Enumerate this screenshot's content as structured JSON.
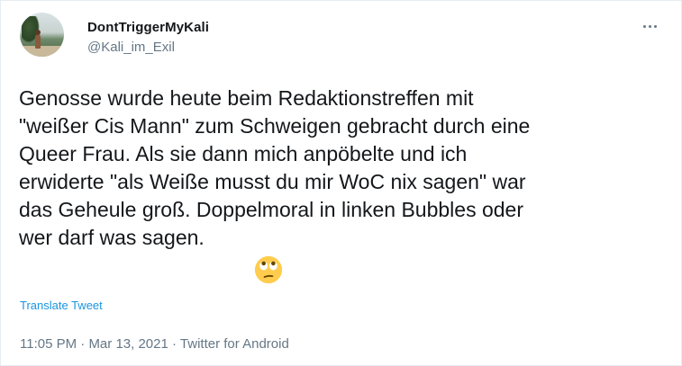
{
  "tweet": {
    "display_name": "DontTriggerMyKali",
    "handle": "@Kali_im_Exil",
    "text_lines": [
      "Genosse wurde heute beim Redaktionstreffen mit",
      "\"weißer Cis Mann\" zum Schweigen gebracht durch eine",
      "Queer Frau. Als sie dann mich anpöbelte und ich",
      "erwiderte \"als Weiße musst du mir WoC nix sagen\" war",
      "das Geheule groß. Doppelmoral in linken Bubbles oder",
      "wer darf was sagen."
    ],
    "emoji": "face-with-rolling-eyes",
    "translate_label": "Translate Tweet",
    "time": "11:05 PM",
    "separator": "·",
    "date": "Mar 13, 2021",
    "source": "Twitter for Android"
  },
  "icons": {
    "more": "more-horizontal-icon"
  },
  "colors": {
    "text": "#14171a",
    "secondary": "#657786",
    "link": "#1b95e0",
    "emoji_face": "#ffcc4d"
  }
}
